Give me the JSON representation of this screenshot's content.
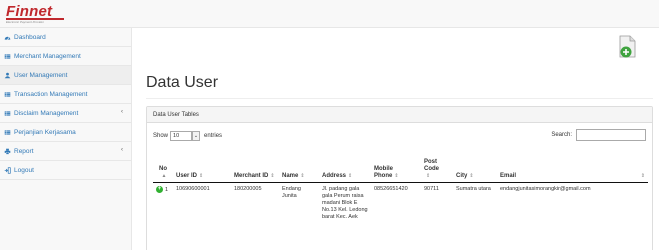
{
  "brand": {
    "name": "Finnet",
    "tagline": "Electronic Payment Provider",
    "color": "#c0282d"
  },
  "sidebar": {
    "items": [
      {
        "label": "Dashboard",
        "icon": "dashboard-icon",
        "arrow": ""
      },
      {
        "label": "Merchant Management",
        "icon": "table-icon",
        "arrow": ""
      },
      {
        "label": "User Management",
        "icon": "user-icon",
        "arrow": "",
        "active": true
      },
      {
        "label": "Transaction Management",
        "icon": "table-icon",
        "arrow": ""
      },
      {
        "label": "Disclaim Management",
        "icon": "table-icon",
        "arrow": "‹"
      },
      {
        "label": "Perjanjian Kerjasama",
        "icon": "table-icon",
        "arrow": ""
      },
      {
        "label": "Report",
        "icon": "print-icon",
        "arrow": "‹"
      },
      {
        "label": "Logout",
        "icon": "sign-out-icon",
        "arrow": ""
      }
    ]
  },
  "main": {
    "title": "Data User",
    "panel_title": "Data User Tables",
    "show_label": "Show",
    "page_length": "10",
    "entries_label": "entries",
    "search_label": "Search:",
    "search_value": "",
    "add_icon": "add-user-icon"
  },
  "table": {
    "columns": [
      {
        "label": "No",
        "sort": "▲"
      },
      {
        "label": "User ID",
        "sort": "⇕"
      },
      {
        "label": "Merchant ID",
        "sort": "⇕"
      },
      {
        "label": "Name",
        "sort": "⇕"
      },
      {
        "label": "Address",
        "sort": "⇕"
      },
      {
        "label": "Mobile Phone",
        "sort": "⇕"
      },
      {
        "label": "Post Code",
        "sort": "⇕"
      },
      {
        "label": "City",
        "sort": "⇕"
      },
      {
        "label": "Email",
        "sort": "⇕"
      }
    ],
    "rows": [
      {
        "no": "1",
        "user_id": "10690600001",
        "merchant_id": "180200005",
        "name": "Endang Junita",
        "address": "Jl. padang gala gala Perum raisa madani Blok E No.13 Kel. Ledong barat Kec. Aek",
        "mobile_phone": "08526651420",
        "post_code": "90711",
        "city": "Sumatra utara",
        "email": "endangjunitasimorangkir@gmail.com"
      }
    ]
  }
}
